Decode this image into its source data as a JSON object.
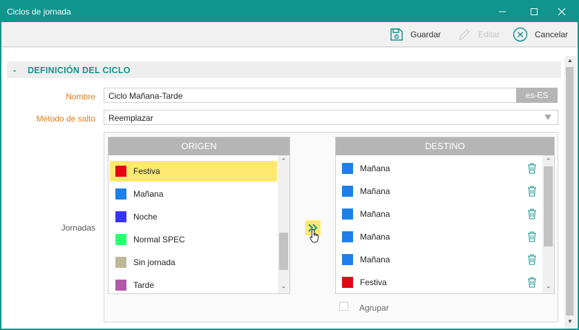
{
  "window": {
    "title": "Ciclos de jornada"
  },
  "toolbar": {
    "save_label": "Guardar",
    "edit_label": "Editar",
    "cancel_label": "Cancelar"
  },
  "section": {
    "collapse_symbol": "-",
    "title": "DEFINICIÓN DEL CICLO"
  },
  "form": {
    "nombre_label": "Nombre",
    "nombre_value": "Ciclo Mañana-Tarde",
    "nombre_lang": "es-ES",
    "metodo_label": "Método de salto",
    "metodo_value": "Reemplazar",
    "jornadas_label": "Jornadas"
  },
  "origen": {
    "header": "ORIGEN",
    "items": [
      {
        "label": "Festiva",
        "color": "#e30613",
        "selected": true
      },
      {
        "label": "Mañana",
        "color": "#1e7fe8"
      },
      {
        "label": "Noche",
        "color": "#3535ff"
      },
      {
        "label": "Normal SPEC",
        "color": "#2dff6a"
      },
      {
        "label": "Sin jornada",
        "color": "#bdb898"
      },
      {
        "label": "Tarde",
        "color": "#b25aa8"
      }
    ]
  },
  "destino": {
    "header": "DESTINO",
    "items": [
      {
        "label": "Mañana",
        "color": "#1e7fe8"
      },
      {
        "label": "Mañana",
        "color": "#1e7fe8"
      },
      {
        "label": "Mañana",
        "color": "#1e7fe8"
      },
      {
        "label": "Mañana",
        "color": "#1e7fe8"
      },
      {
        "label": "Mañana",
        "color": "#1e7fe8"
      },
      {
        "label": "Festiva",
        "color": "#e30613"
      }
    ]
  },
  "agrupar": {
    "label": "Agrupar",
    "checked": false
  },
  "colors": {
    "accent": "#10948c",
    "label_orange": "#e07a17",
    "selection": "#fde972"
  }
}
